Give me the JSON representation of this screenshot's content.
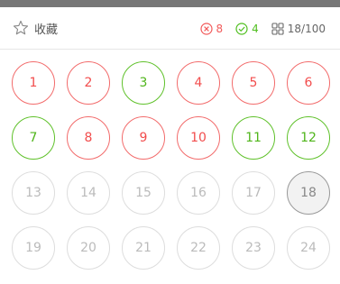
{
  "header": {
    "favorite_label": "收藏",
    "wrong_count": "8",
    "correct_count": "4",
    "progress": "18/100"
  },
  "colors": {
    "wrong": "#f24d4d",
    "correct": "#4fb51a",
    "unanswered": "#bbbbbb",
    "current_bg": "#f2f2f2"
  },
  "questions": [
    {
      "label": "1",
      "status": "wrong"
    },
    {
      "label": "2",
      "status": "wrong"
    },
    {
      "label": "3",
      "status": "correct"
    },
    {
      "label": "4",
      "status": "wrong"
    },
    {
      "label": "5",
      "status": "wrong"
    },
    {
      "label": "6",
      "status": "wrong"
    },
    {
      "label": "7",
      "status": "correct"
    },
    {
      "label": "8",
      "status": "wrong"
    },
    {
      "label": "9",
      "status": "wrong"
    },
    {
      "label": "10",
      "status": "wrong"
    },
    {
      "label": "11",
      "status": "correct"
    },
    {
      "label": "12",
      "status": "correct"
    },
    {
      "label": "13",
      "status": "unanswered"
    },
    {
      "label": "14",
      "status": "unanswered"
    },
    {
      "label": "15",
      "status": "unanswered"
    },
    {
      "label": "16",
      "status": "unanswered"
    },
    {
      "label": "17",
      "status": "unanswered"
    },
    {
      "label": "18",
      "status": "current"
    },
    {
      "label": "19",
      "status": "unanswered"
    },
    {
      "label": "20",
      "status": "unanswered"
    },
    {
      "label": "21",
      "status": "unanswered"
    },
    {
      "label": "22",
      "status": "unanswered"
    },
    {
      "label": "23",
      "status": "unanswered"
    },
    {
      "label": "24",
      "status": "unanswered"
    }
  ]
}
